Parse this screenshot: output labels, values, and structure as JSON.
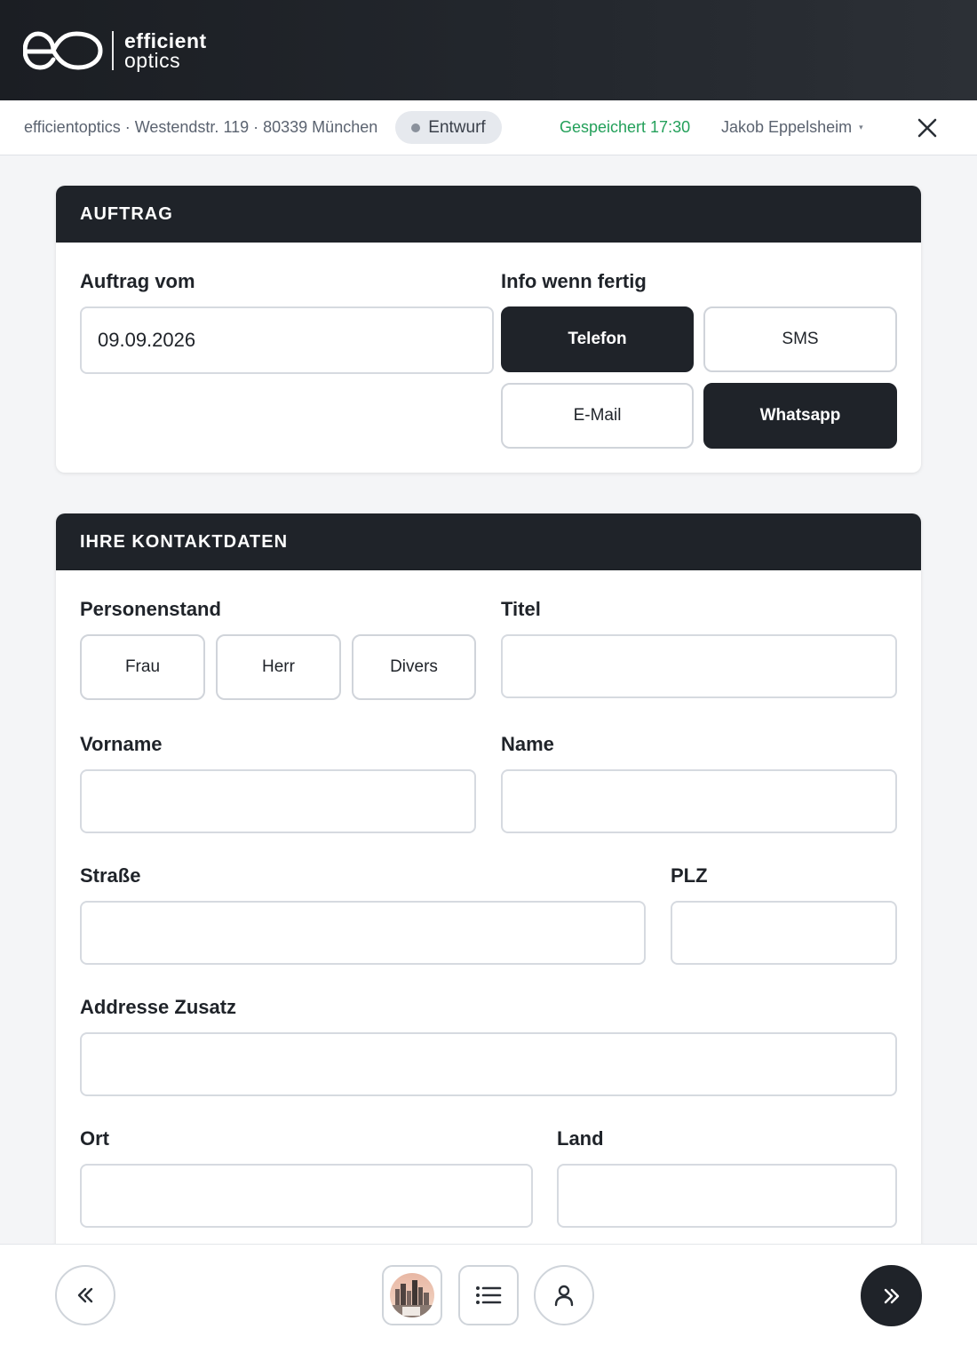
{
  "header": {
    "logo_line1": "efficient",
    "logo_line2": "optics"
  },
  "info_bar": {
    "address": "efficientoptics · Westendstr. 119 · 80339 München",
    "status": "Entwurf",
    "saved": "Gespeichert 17:30",
    "user": "Jakob Eppelsheim",
    "user_caret": "▾"
  },
  "auftrag": {
    "title": "AUFTRAG",
    "date_label": "Auftrag vom",
    "date_value": "09.09.2026",
    "info_label": "Info wenn fertig",
    "options": [
      {
        "label": "Telefon",
        "active": true
      },
      {
        "label": "SMS",
        "active": false
      },
      {
        "label": "E-Mail",
        "active": false
      },
      {
        "label": "Whatsapp",
        "active": true
      }
    ]
  },
  "kontakt": {
    "title": "IHRE KONTAKTDATEN",
    "personenstand_label": "Personenstand",
    "personenstand_options": [
      "Frau",
      "Herr",
      "Divers"
    ],
    "titel_label": "Titel",
    "vorname_label": "Vorname",
    "name_label": "Name",
    "strasse_label": "Straße",
    "plz_label": "PLZ",
    "zusatz_label": "Addresse Zusatz",
    "ort_label": "Ort",
    "land_label": "Land",
    "titel_value": "",
    "vorname_value": "",
    "name_value": "",
    "strasse_value": "",
    "plz_value": "",
    "zusatz_value": "",
    "ort_value": "",
    "land_value": ""
  },
  "colors": {
    "dark": "#1f2329",
    "saved_green": "#23a05a",
    "border": "#d6dae0"
  },
  "bottom_bar": {
    "back_icon": "double-chevron-left-icon",
    "photo_icon": "city-photo-thumbnail",
    "list_icon": "list-icon",
    "user_icon": "user-icon",
    "next_icon": "double-chevron-right-icon"
  }
}
